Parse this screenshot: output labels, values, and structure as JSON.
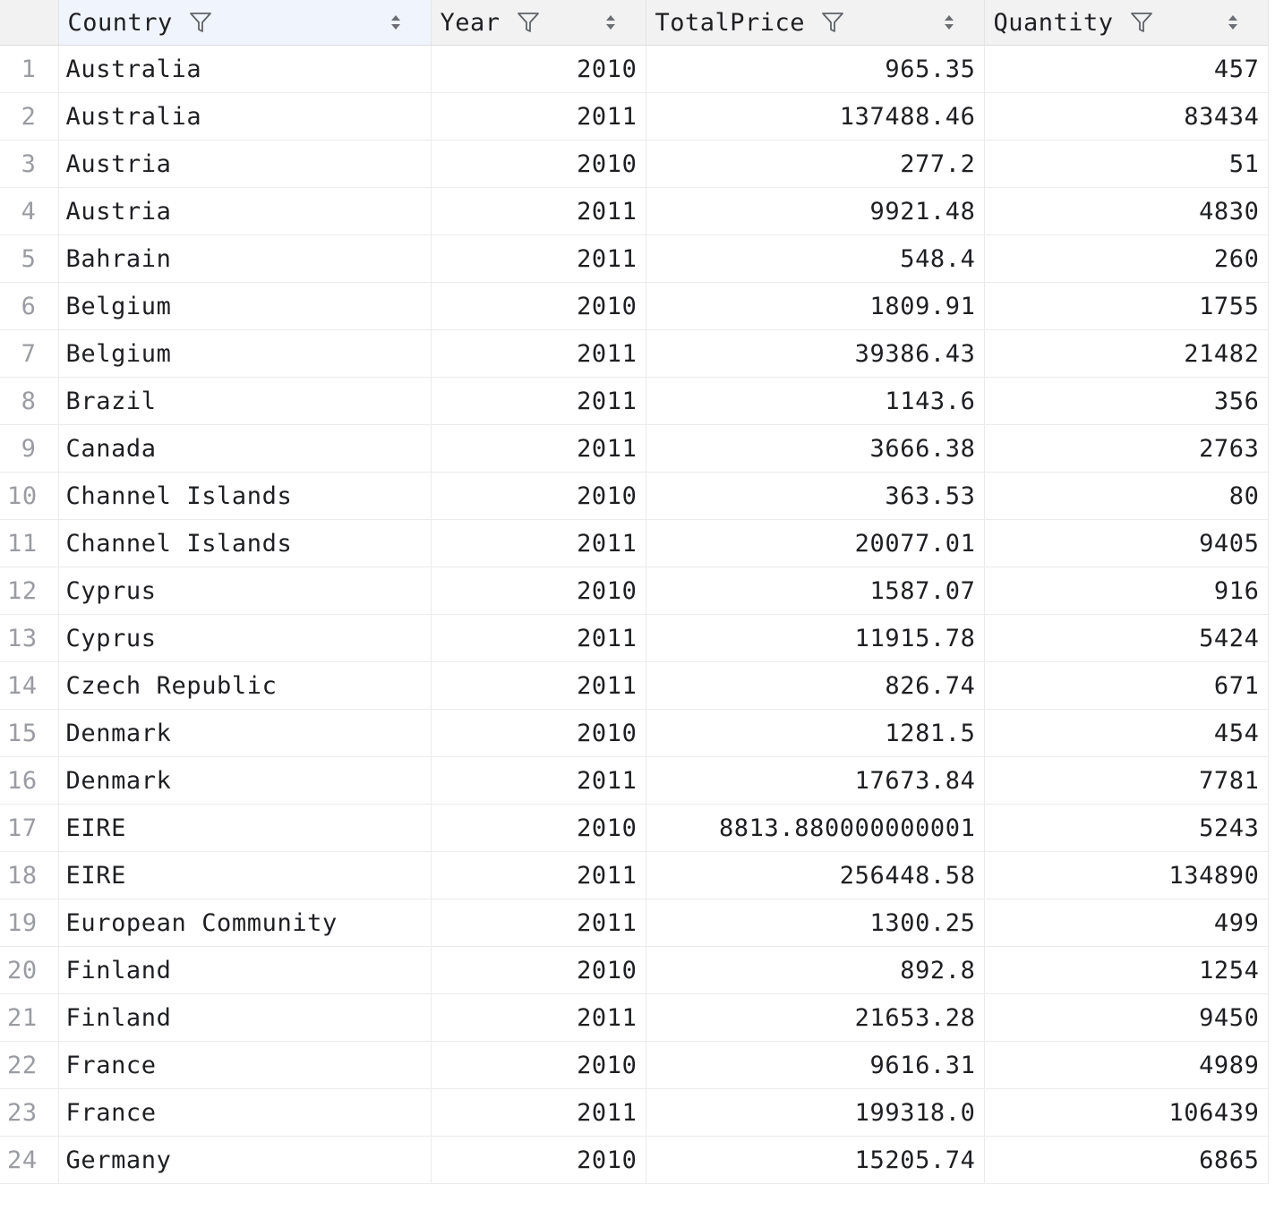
{
  "columns": [
    {
      "label": "Country"
    },
    {
      "label": "Year"
    },
    {
      "label": "TotalPrice"
    },
    {
      "label": "Quantity"
    }
  ],
  "rows": [
    {
      "n": "1",
      "country": "Australia",
      "year": "2010",
      "price": "965.35",
      "qty": "457"
    },
    {
      "n": "2",
      "country": "Australia",
      "year": "2011",
      "price": "137488.46",
      "qty": "83434"
    },
    {
      "n": "3",
      "country": "Austria",
      "year": "2010",
      "price": "277.2",
      "qty": "51"
    },
    {
      "n": "4",
      "country": "Austria",
      "year": "2011",
      "price": "9921.48",
      "qty": "4830"
    },
    {
      "n": "5",
      "country": "Bahrain",
      "year": "2011",
      "price": "548.4",
      "qty": "260"
    },
    {
      "n": "6",
      "country": "Belgium",
      "year": "2010",
      "price": "1809.91",
      "qty": "1755"
    },
    {
      "n": "7",
      "country": "Belgium",
      "year": "2011",
      "price": "39386.43",
      "qty": "21482"
    },
    {
      "n": "8",
      "country": "Brazil",
      "year": "2011",
      "price": "1143.6",
      "qty": "356"
    },
    {
      "n": "9",
      "country": "Canada",
      "year": "2011",
      "price": "3666.38",
      "qty": "2763"
    },
    {
      "n": "10",
      "country": "Channel Islands",
      "year": "2010",
      "price": "363.53",
      "qty": "80"
    },
    {
      "n": "11",
      "country": "Channel Islands",
      "year": "2011",
      "price": "20077.01",
      "qty": "9405"
    },
    {
      "n": "12",
      "country": "Cyprus",
      "year": "2010",
      "price": "1587.07",
      "qty": "916"
    },
    {
      "n": "13",
      "country": "Cyprus",
      "year": "2011",
      "price": "11915.78",
      "qty": "5424"
    },
    {
      "n": "14",
      "country": "Czech Republic",
      "year": "2011",
      "price": "826.74",
      "qty": "671"
    },
    {
      "n": "15",
      "country": "Denmark",
      "year": "2010",
      "price": "1281.5",
      "qty": "454"
    },
    {
      "n": "16",
      "country": "Denmark",
      "year": "2011",
      "price": "17673.84",
      "qty": "7781"
    },
    {
      "n": "17",
      "country": "EIRE",
      "year": "2010",
      "price": "8813.880000000001",
      "qty": "5243"
    },
    {
      "n": "18",
      "country": "EIRE",
      "year": "2011",
      "price": "256448.58",
      "qty": "134890"
    },
    {
      "n": "19",
      "country": "European Community",
      "year": "2011",
      "price": "1300.25",
      "qty": "499"
    },
    {
      "n": "20",
      "country": "Finland",
      "year": "2010",
      "price": "892.8",
      "qty": "1254"
    },
    {
      "n": "21",
      "country": "Finland",
      "year": "2011",
      "price": "21653.28",
      "qty": "9450"
    },
    {
      "n": "22",
      "country": "France",
      "year": "2010",
      "price": "9616.31",
      "qty": "4989"
    },
    {
      "n": "23",
      "country": "France",
      "year": "2011",
      "price": "199318.0",
      "qty": "106439"
    },
    {
      "n": "24",
      "country": "Germany",
      "year": "2010",
      "price": "15205.74",
      "qty": "6865"
    }
  ],
  "icons": {
    "filter": "filter-icon",
    "sort": "sort-icon"
  },
  "colors": {
    "header_bg": "#f2f2f2",
    "selected_header_bg": "#f0f4fc",
    "row_number": "#9a9ca2",
    "text": "#1e1f22"
  }
}
